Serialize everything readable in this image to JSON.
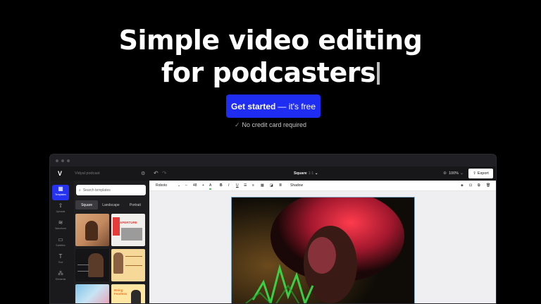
{
  "hero": {
    "title_line1": "Simple video editing",
    "title_line2": "for podcasters",
    "cta_main": "Get started",
    "cta_suffix": "— it's free",
    "note": "No credit card required",
    "note_icon": "check-icon",
    "cta_color": "#1f2cf2"
  },
  "editor": {
    "logo": "V",
    "project_name": "Vidyal podcast",
    "format": "Square",
    "ratio": "1:1",
    "zoom": "100%",
    "export_label": "Export",
    "rail": [
      {
        "label": "Templates",
        "icon": "grid-icon"
      },
      {
        "label": "Uploads",
        "icon": "upload-icon"
      },
      {
        "label": "Waveform",
        "icon": "waveform-icon"
      },
      {
        "label": "Subtitles",
        "icon": "subtitles-icon"
      },
      {
        "label": "Text",
        "icon": "text-icon"
      },
      {
        "label": "Elements",
        "icon": "elements-icon"
      }
    ],
    "search_placeholder": "Search templates",
    "tabs": [
      "Square",
      "Landscape",
      "Portrait"
    ],
    "thumb_texts": [
      "APERTURE",
      "Being Fearless"
    ],
    "toolbar": {
      "font": "Roboto",
      "size": "48",
      "minus": "–",
      "plus": "+",
      "color_letter": "A",
      "bold": "B",
      "italic": "I",
      "underline": "U",
      "shadow": "Shadow"
    }
  }
}
